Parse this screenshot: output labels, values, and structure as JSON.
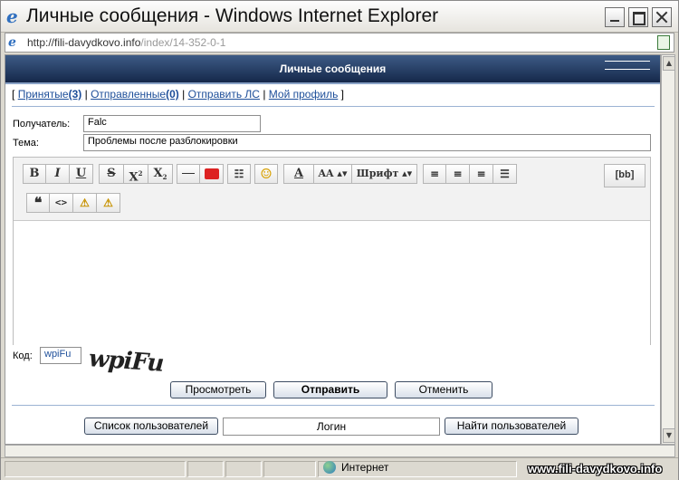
{
  "window": {
    "title": "Личные сообщения - Windows Internet Explorer",
    "url_host": "http://fili-davydkovo.info",
    "url_path": "/index/14-352-0-1"
  },
  "page": {
    "header_title": "Личные сообщения",
    "nav": {
      "open_bracket": "[",
      "close_bracket": "]",
      "separator": "|",
      "inbox_label": "Принятые",
      "inbox_count": "(3)",
      "sent_label": "Отправленные",
      "sent_count": "(0)",
      "compose_label": "Отправить ЛС",
      "profile_label": "Мой профиль"
    },
    "form": {
      "recipient_label": "Получатель:",
      "recipient_value": "Falc",
      "subject_label": "Тема:",
      "subject_value": "Проблемы после разблокировки",
      "captcha_label": "Код:",
      "captcha_value": "wpiFu",
      "captcha_image_text": "wpiFu"
    },
    "toolbar": {
      "bold": "B",
      "italic": "I",
      "underline": "U",
      "strike": "S",
      "superscript": "X",
      "subscript": "X",
      "color_letter": "A",
      "size_label": "AA",
      "font_label": "Шрифт",
      "bbcode_label": "[bb]"
    },
    "buttons": {
      "preview": "Просмотреть",
      "send": "Отправить",
      "cancel": "Отменить",
      "user_list": "Список пользователей",
      "login_field": "Логин",
      "find_user": "Найти пользователей"
    },
    "colors": {
      "header_top": "#3d5b86",
      "header_bottom": "#15284a",
      "link": "#1d4e99"
    }
  },
  "statusbar": {
    "zone": "Интернет",
    "watermark": "www.fili-davydkovo.info"
  }
}
